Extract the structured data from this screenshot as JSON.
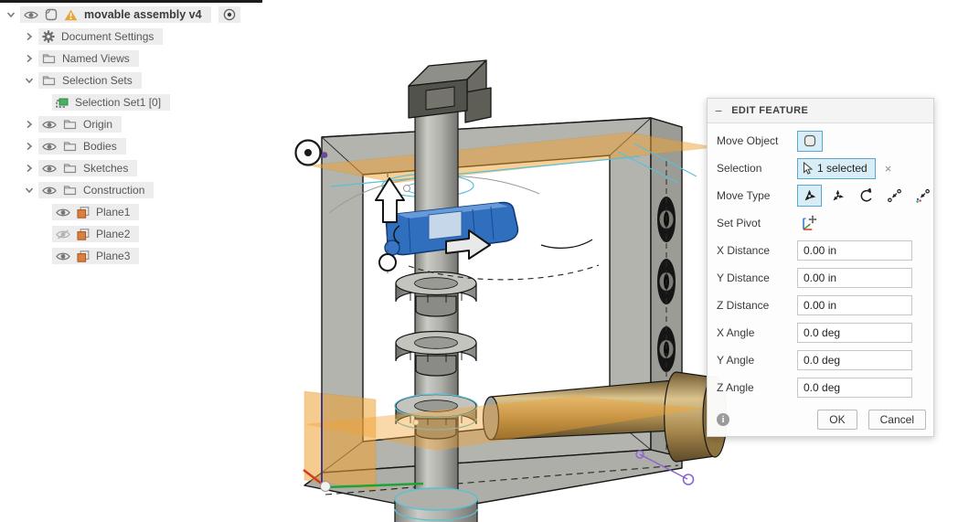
{
  "browser": {
    "items": [
      {
        "label": "movable assembly v4",
        "level": 0,
        "chevron": "down",
        "eye": "visible",
        "icon": "component",
        "warning": true,
        "radio": true,
        "bold": true
      },
      {
        "label": "Document Settings",
        "level": 1,
        "chevron": "right",
        "icon": "gear"
      },
      {
        "label": "Named Views",
        "level": 1,
        "chevron": "right",
        "icon": "folder"
      },
      {
        "label": "Selection Sets",
        "level": 1,
        "chevron": "down",
        "icon": "folder"
      },
      {
        "label": "Selection Set1 [0]",
        "level": 2,
        "icon": "selection-set"
      },
      {
        "label": "Origin",
        "level": 1,
        "chevron": "right",
        "eye": "visible",
        "icon": "folder"
      },
      {
        "label": "Bodies",
        "level": 1,
        "chevron": "right",
        "eye": "visible",
        "icon": "folder"
      },
      {
        "label": "Sketches",
        "level": 1,
        "chevron": "right",
        "eye": "visible",
        "icon": "folder"
      },
      {
        "label": "Construction",
        "level": 1,
        "chevron": "down",
        "eye": "visible",
        "icon": "folder"
      },
      {
        "label": "Plane1",
        "level": 2,
        "eye": "visible",
        "icon": "plane"
      },
      {
        "label": "Plane2",
        "level": 2,
        "eye": "hidden",
        "icon": "plane"
      },
      {
        "label": "Plane3",
        "level": 2,
        "eye": "visible",
        "icon": "plane"
      }
    ]
  },
  "dialog": {
    "title": "EDIT FEATURE",
    "move_object_label": "Move Object",
    "selection_label": "Selection",
    "selection_value": "1 selected",
    "clear_selection": "×",
    "move_type_label": "Move Type",
    "move_types": [
      {
        "name": "translate",
        "selected": true
      },
      {
        "name": "free-move",
        "selected": false
      },
      {
        "name": "rotate",
        "selected": false
      },
      {
        "name": "point-to-point",
        "selected": false
      },
      {
        "name": "point-to-position",
        "selected": false
      }
    ],
    "set_pivot_label": "Set Pivot",
    "fields": [
      {
        "label": "X Distance",
        "value": "0.00 in"
      },
      {
        "label": "Y Distance",
        "value": "0.00 in"
      },
      {
        "label": "Z Distance",
        "value": "0.00 in"
      },
      {
        "label": "X Angle",
        "value": "0.0 deg"
      },
      {
        "label": "Y Angle",
        "value": "0.0 deg"
      },
      {
        "label": "Z Angle",
        "value": "0.0 deg"
      }
    ],
    "ok_label": "OK",
    "cancel_label": "Cancel"
  },
  "colors": {
    "accent_blue": "#0696d7",
    "selection_bg": "#d9edf7",
    "selection_border": "#5aa7d2",
    "plane_orange": "#f0a232",
    "selected_body_blue": "#2f6fbe",
    "highlight_teal": "#58c0d8",
    "brass": "#a98a50",
    "warning_orange": "#e8a33b",
    "selection_set_green": "#4cae5f",
    "axis_red": "#d6392b",
    "axis_green": "#1fa337",
    "axis_blue": "#2e2f91",
    "construction_purple": "#8a63d2"
  }
}
